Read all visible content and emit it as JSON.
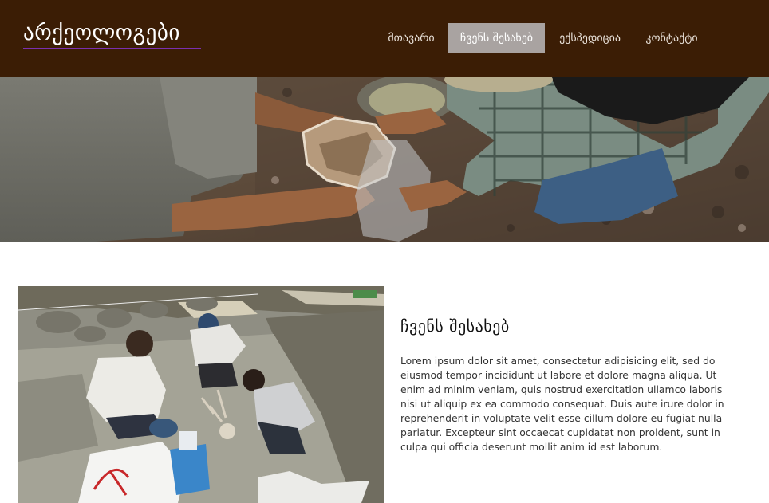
{
  "site": {
    "logo_text": "არქეოლოგები"
  },
  "nav": {
    "items": [
      {
        "label": "მთავარი",
        "active": false
      },
      {
        "label": "ჩვენს შესახებ",
        "active": true
      },
      {
        "label": "ექსპედიცია",
        "active": false
      },
      {
        "label": "კონტაქტი",
        "active": false
      }
    ]
  },
  "about": {
    "title": "ჩვენს შესახებ",
    "body": "Lorem ipsum dolor sit amet, consectetur adipisicing elit, sed do eiusmod tempor incididunt ut labore et dolore magna aliqua. Ut enim ad minim veniam, quis nostrud exercitation ullamco laboris nisi ut aliquip ex ea commodo consequat. Duis aute irure dolor in reprehenderit in voluptate velit esse cillum dolore eu fugiat nulla pariatur. Excepteur sint occaecat cupidatat non proident, sunt in culpa qui officia deserunt mollit anim id est laborum."
  },
  "colors": {
    "header_bg": "#3b1d05",
    "active_nav_bg": "#a9a3a1",
    "logo_underline": "#7b2fb0"
  }
}
